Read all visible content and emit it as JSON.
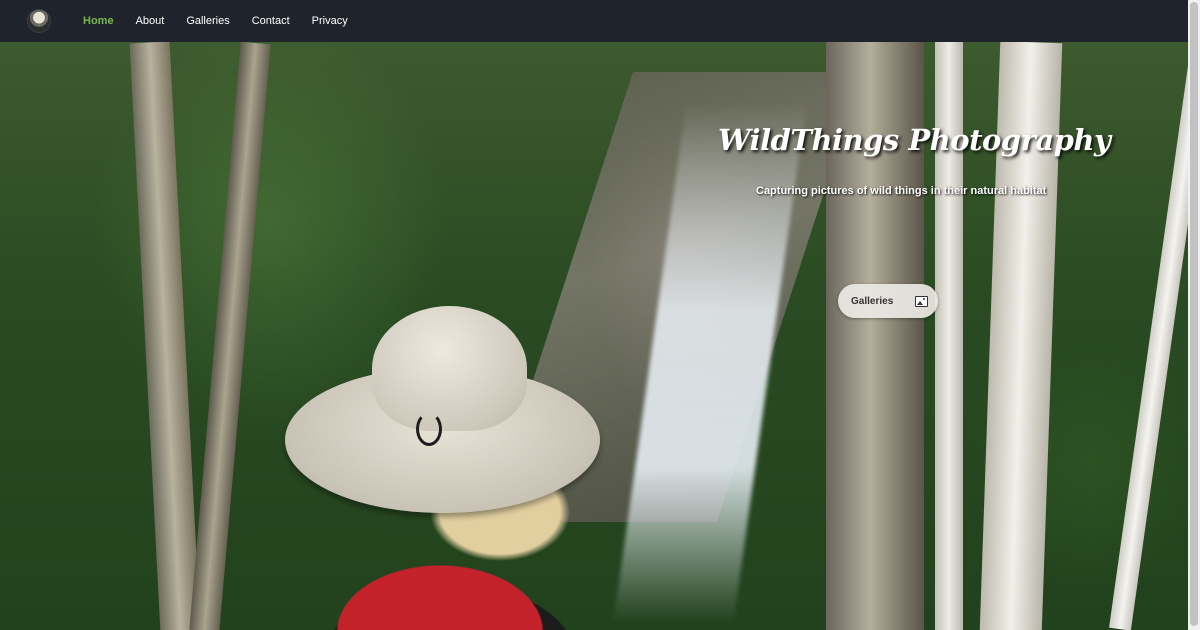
{
  "nav": {
    "logo_icon": "site-logo",
    "links": [
      "Home",
      "About",
      "Galleries",
      "Contact",
      "Privacy"
    ],
    "active": "Home",
    "active_color": "#79b84f"
  },
  "hero": {
    "title": "WildThings Photography",
    "subtitle": "Capturing pictures of wild things in their natural habitat",
    "button": {
      "label": "Galleries",
      "icon": "image-icon"
    }
  }
}
